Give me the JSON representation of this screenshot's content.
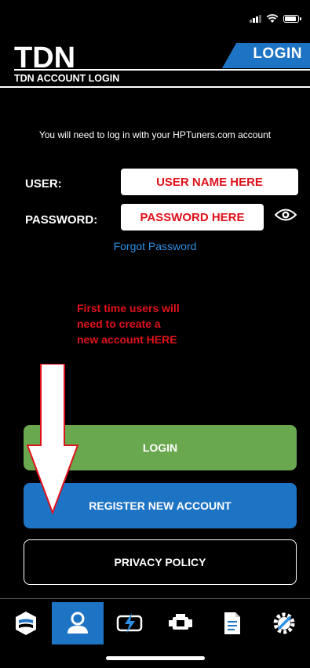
{
  "status_bar": {
    "signal_icon": "signal-icon",
    "wifi_icon": "wifi-icon",
    "battery_icon": "battery-icon"
  },
  "header": {
    "logo_text": "TDN",
    "tab_label": "LOGIN",
    "subtitle": "TDN ACCOUNT LOGIN"
  },
  "form": {
    "info_text": "You will need to log in with your HPTuners.com account",
    "user_label": "USER:",
    "user_value": "USER NAME HERE",
    "password_label": "PASSWORD:",
    "password_value": "PASSWORD HERE",
    "forgot_label": "Forgot Password"
  },
  "annotation": {
    "line1": "First time users will",
    "line2": "need to create a",
    "line3": "new account HERE"
  },
  "buttons": {
    "login": "LOGIN",
    "register": "REGISTER NEW ACCOUNT",
    "privacy": "PRIVACY POLICY"
  },
  "nav": {
    "items": [
      {
        "icon": "shield-logo-icon",
        "active": false
      },
      {
        "icon": "user-icon",
        "active": true
      },
      {
        "icon": "lightning-device-icon",
        "active": false
      },
      {
        "icon": "engine-icon",
        "active": false
      },
      {
        "icon": "document-icon",
        "active": false
      },
      {
        "icon": "settings-wrench-icon",
        "active": false
      }
    ]
  },
  "colors": {
    "background": "#000000",
    "accent_blue": "#1e74c4",
    "login_green": "#6aa84f",
    "annotation_red": "#e0111b",
    "link_blue": "#2d8fe3"
  }
}
